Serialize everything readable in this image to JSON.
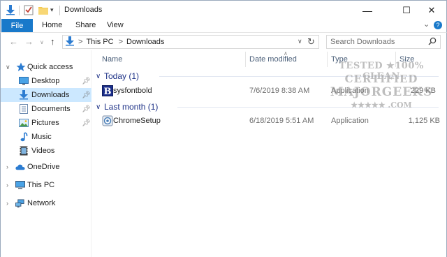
{
  "window": {
    "title": "Downloads",
    "controls": {
      "minimize": "—",
      "maximize": "☐",
      "close": "✕"
    }
  },
  "ribbon": {
    "tabs": [
      {
        "label": "File"
      },
      {
        "label": "Home"
      },
      {
        "label": "Share"
      },
      {
        "label": "View"
      }
    ],
    "expand_glyph": "⌄",
    "help_glyph": "?"
  },
  "address": {
    "path": [
      "This PC",
      "Downloads"
    ],
    "separator": ">",
    "search_placeholder": "Search Downloads"
  },
  "nav_pane": {
    "items": [
      {
        "label": "Quick access",
        "icon": "star-icon"
      },
      {
        "label": "Desktop",
        "icon": "desktop-icon"
      },
      {
        "label": "Downloads",
        "icon": "download-arrow-icon",
        "selected": true
      },
      {
        "label": "Documents",
        "icon": "documents-icon"
      },
      {
        "label": "Pictures",
        "icon": "pictures-icon"
      },
      {
        "label": "Music",
        "icon": "music-icon"
      },
      {
        "label": "Videos",
        "icon": "videos-icon"
      },
      {
        "label": "OneDrive",
        "icon": "cloud-icon"
      },
      {
        "label": "This PC",
        "icon": "computer-icon"
      },
      {
        "label": "Network",
        "icon": "network-icon"
      }
    ]
  },
  "columns": {
    "name": "Name",
    "date": "Date modified",
    "type": "Type",
    "size": "Size"
  },
  "groups": [
    {
      "label": "Today (1)",
      "files": [
        {
          "name": "sysfontbold",
          "date": "7/6/2019 8:38 AM",
          "type": "Application",
          "size": "229 KB",
          "icon": "app-b-icon"
        }
      ]
    },
    {
      "label": "Last month (1)",
      "files": [
        {
          "name": "ChromeSetup",
          "date": "6/18/2019 5:51 AM",
          "type": "Application",
          "size": "1,125 KB",
          "icon": "installer-icon"
        }
      ]
    }
  ],
  "watermark": {
    "line1": "TESTED ★100% CLEAN",
    "line2": "CERTIFIED",
    "line3": "MAJORGEEKS",
    "line4": "★★★★★ .COM"
  },
  "colors": {
    "accent": "#1979ca",
    "selection": "#cce8ff",
    "group_text": "#1e3287",
    "header_text": "#4c607a"
  }
}
